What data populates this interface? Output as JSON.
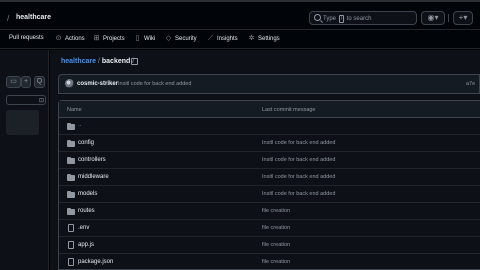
{
  "header": {
    "repo_separator": "/",
    "repo_name": "healthcare",
    "search_placeholder_before": "Type",
    "search_key": "/",
    "search_placeholder_after": "to search",
    "copilot_icon": "copilot-icon",
    "plus_icon": "plus-icon"
  },
  "nav": {
    "items": [
      {
        "label": "Pull requests",
        "icon": "pull-request-icon"
      },
      {
        "label": "Actions",
        "icon": "play-icon"
      },
      {
        "label": "Projects",
        "icon": "table-icon"
      },
      {
        "label": "Wiki",
        "icon": "book-icon"
      },
      {
        "label": "Security",
        "icon": "shield-icon"
      },
      {
        "label": "Insights",
        "icon": "graph-icon"
      },
      {
        "label": "Settings",
        "icon": "gear-icon"
      }
    ]
  },
  "sidebar": {
    "add_label": "+",
    "search_label": "Q",
    "filter_label": "⊡"
  },
  "breadcrumb": {
    "repo": "healthcare",
    "sep1": "/",
    "folder": "backend",
    "sep2": "/"
  },
  "commit": {
    "author": "cosmic-striker",
    "message": "Insitl code for back end added",
    "sha": "a7e"
  },
  "table": {
    "col_name": "Name",
    "col_message": "Last commit message",
    "parent_label": "..",
    "rows": [
      {
        "name": "config",
        "type": "folder",
        "message": "Insitl code for back end added"
      },
      {
        "name": "controllers",
        "type": "folder",
        "message": "Insitl code for back end added"
      },
      {
        "name": "middleware",
        "type": "folder",
        "message": "Insitl code for back end added"
      },
      {
        "name": "models",
        "type": "folder",
        "message": "Insitl code for back end added"
      },
      {
        "name": "routes",
        "type": "folder",
        "message": "file creation"
      },
      {
        "name": ".env",
        "type": "file",
        "message": "file creation"
      },
      {
        "name": "app.js",
        "type": "file",
        "message": "file creation"
      },
      {
        "name": "package.json",
        "type": "file",
        "message": "file creation"
      }
    ]
  }
}
